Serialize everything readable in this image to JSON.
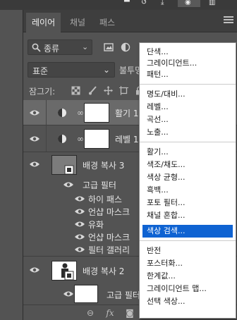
{
  "tabs": [
    {
      "label": "레이어"
    },
    {
      "label": "채널"
    },
    {
      "label": "패스"
    }
  ],
  "filter": {
    "label": "종류"
  },
  "blend": {
    "mode": "표준",
    "opacity_label": "불투명"
  },
  "lock": {
    "label": "잠그기:"
  },
  "layers": {
    "adj1": {
      "name": "활기 1"
    },
    "adj2": {
      "name": "레벨 1"
    },
    "bg3": {
      "name": "배경 복사 3",
      "filters_label": "고급 필터",
      "filters": [
        "하이 패스",
        "언샵 마스크",
        "유화",
        "언샵 마스크",
        "필터 갤러리"
      ]
    },
    "bg2": {
      "name": "배경 복사 2",
      "filters_label": "고급 필터"
    }
  },
  "menu": {
    "groups": [
      [
        "단색...",
        "그레이디언트...",
        "패턴..."
      ],
      [
        "명도/대비...",
        "레벨...",
        "곡선...",
        "노출..."
      ],
      [
        "활기...",
        "색조/채도...",
        "색상 균형...",
        "흑백...",
        "포토 필터...",
        "채널 혼합...",
        "색상 검색..."
      ],
      [
        "반전",
        "포스터화...",
        "한계값...",
        "그레이디언트 맵...",
        "선택 색상..."
      ]
    ],
    "highlighted": "색상 검색..."
  },
  "colors": {
    "panel_bg": "#535353",
    "tabbar_bg": "#3e3e3e",
    "selected_layer": "#6a6a6a",
    "menu_highlight": "#0f63d2"
  }
}
